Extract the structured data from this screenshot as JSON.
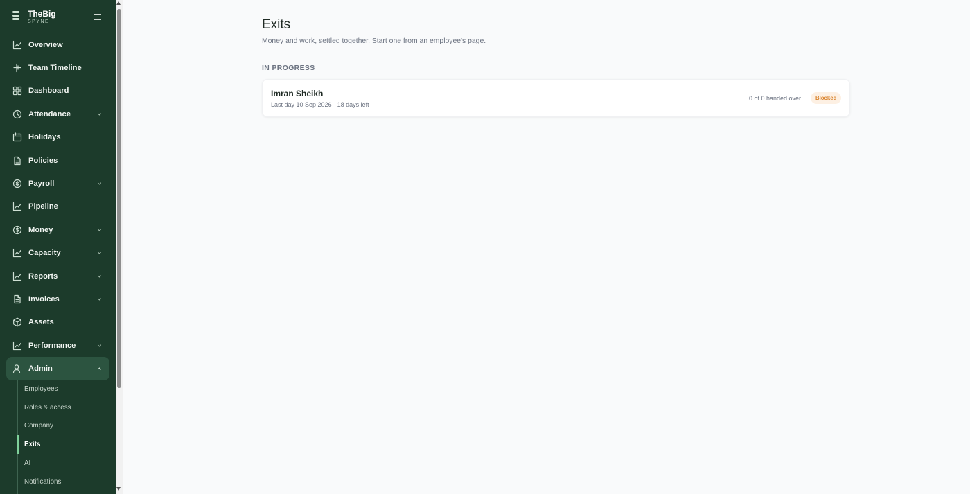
{
  "brand": {
    "name": "TheBig",
    "sub": "SPYNE"
  },
  "nav": {
    "items": [
      {
        "label": "Overview",
        "icon": "chart-line-icon",
        "chevron": false
      },
      {
        "label": "Team Timeline",
        "icon": "timeline-icon",
        "chevron": false
      },
      {
        "label": "Dashboard",
        "icon": "grid-icon",
        "chevron": false
      },
      {
        "label": "Attendance",
        "icon": "clock-icon",
        "chevron": true
      },
      {
        "label": "Holidays",
        "icon": "calendar-icon",
        "chevron": false
      },
      {
        "label": "Policies",
        "icon": "document-icon",
        "chevron": false
      },
      {
        "label": "Payroll",
        "icon": "dollar-circle-icon",
        "chevron": true
      },
      {
        "label": "Pipeline",
        "icon": "chart-line-icon",
        "chevron": false
      },
      {
        "label": "Money",
        "icon": "dollar-circle-icon",
        "chevron": true
      },
      {
        "label": "Capacity",
        "icon": "chart-line-icon",
        "chevron": true
      },
      {
        "label": "Reports",
        "icon": "chart-line-icon",
        "chevron": true
      },
      {
        "label": "Invoices",
        "icon": "document-icon",
        "chevron": true
      },
      {
        "label": "Assets",
        "icon": "box-icon",
        "chevron": false
      },
      {
        "label": "Performance",
        "icon": "chart-line-icon",
        "chevron": true
      },
      {
        "label": "Admin",
        "icon": "user-icon",
        "chevron": true,
        "expanded": true
      }
    ],
    "admin_sub": [
      "Employees",
      "Roles & access",
      "Company",
      "Exits",
      "AI",
      "Notifications"
    ],
    "active_sub": "Exits"
  },
  "page": {
    "title": "Exits",
    "subtitle": "Money and work, settled together. Start one from an employee's page.",
    "section": "IN PROGRESS"
  },
  "exit": {
    "name": "Imran Sheikh",
    "meta": "Last day 10 Sep 2026 · 18 days left",
    "progress": "0 of 0 handed over",
    "status": "Blocked"
  },
  "colors": {
    "sidebar": "#1c3b2b",
    "active_nav": "#2c5440",
    "badge_bg": "#fdf0e3",
    "badge_text": "#d9822b",
    "background": "#f9fafb"
  }
}
